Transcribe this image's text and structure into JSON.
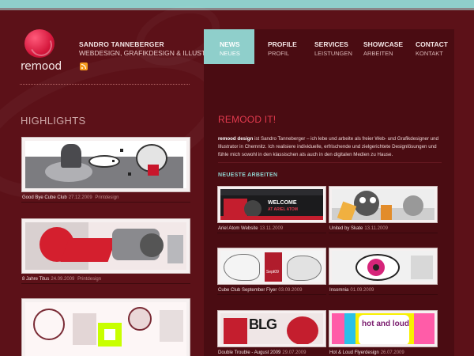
{
  "site": {
    "logo_text": "remood",
    "owner_name": "SANDRO TANNEBERGER",
    "owner_tagline": "WEBDESIGN, GRAFIKDESIGN & ILLUSTRATION",
    "rss_icon": "rss-icon"
  },
  "nav": [
    {
      "label": "NEWS",
      "sub": "NEUES",
      "active": true
    },
    {
      "label": "PROFILE",
      "sub": "PROFIL",
      "active": false
    },
    {
      "label": "SERVICES",
      "sub": "LEISTUNGEN",
      "active": false
    },
    {
      "label": "SHOWCASE",
      "sub": "ARBEITEN",
      "active": false
    },
    {
      "label": "CONTACT",
      "sub": "KONTAKT",
      "active": false
    }
  ],
  "highlights": {
    "title": "HIGHLIGHTS",
    "items": [
      {
        "title": "Good Bye Cube Club",
        "date": "27.12.2009",
        "category": "Printdesign"
      },
      {
        "title": "8 Jahre Titus",
        "date": "24.09.2009",
        "category": "Printdesign"
      },
      {
        "title": "",
        "date": "",
        "category": ""
      }
    ]
  },
  "main": {
    "title": "REMOOD IT!",
    "intro_bold": "remood design",
    "intro_text": " ist Sandro Tanneberger – ich lebe und arbeite als freier Web- und Grafikdesigner und Illustrator in Chemnitz. Ich realisiere individuelle, erfrischende und zielgerichtete Designlösungen und fühle mich sowohl in den klassischen als auch in den digitalen Medien zu Hause.",
    "latest_title": "NEUESTE ARBEITEN",
    "works": [
      {
        "title": "Ariel Atom Website",
        "date": "13.11.2009",
        "banner_top": "WELCOME",
        "banner_bottom": "AT ARIEL ATOM"
      },
      {
        "title": "United by Skate",
        "date": "13.11.2009"
      },
      {
        "title": "Cube Club September Flyer",
        "date": "03.09.2009",
        "art_label": "Sept09"
      },
      {
        "title": "Insomnia",
        "date": "01.09.2009"
      },
      {
        "title": "Double Trouble - August 2009",
        "date": "29.07.2009",
        "art_label": "BLG"
      },
      {
        "title": "Hot & Loud Flyerdesign",
        "date": "26.07.2009",
        "art_label": "hot and loud"
      }
    ]
  },
  "colors": {
    "background": "#5c1118",
    "panel": "#4a0c12",
    "accent_teal": "#8fcfcb",
    "accent_red": "#e23a4e",
    "rss_orange": "#f39a1e"
  }
}
